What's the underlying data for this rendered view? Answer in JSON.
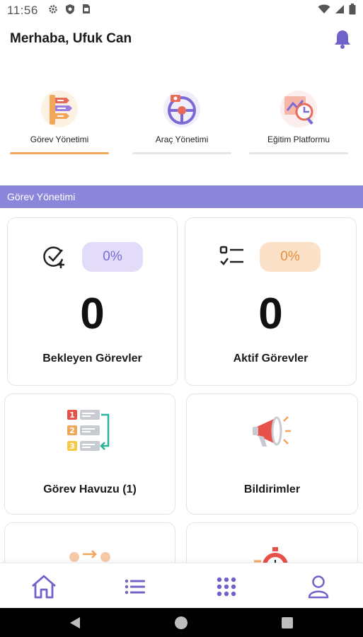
{
  "status_bar": {
    "time": "11:56",
    "icons": [
      "settings-icon",
      "shield-icon",
      "sim-icon",
      "wifi-icon",
      "signal-icon",
      "battery-icon"
    ]
  },
  "header": {
    "greeting": "Merhaba, Ufuk Can",
    "notification_icon": "bell-icon"
  },
  "top_menu": {
    "items": [
      {
        "label": "Görev Yönetimi",
        "icon": "task-list-icon",
        "active": true
      },
      {
        "label": "Araç Yönetimi",
        "icon": "steering-wheel-icon",
        "active": false
      },
      {
        "label": "Eğitim Platformu",
        "icon": "analytics-icon",
        "active": false
      }
    ]
  },
  "section": {
    "title": "Görev Yönetimi"
  },
  "stats": [
    {
      "label": "Bekleyen Görevler",
      "percent": "0%",
      "value": "0",
      "icon": "check-plus-icon",
      "pill_color": "#e3dcf8"
    },
    {
      "label": "Aktif Görevler",
      "percent": "0%",
      "value": "0",
      "icon": "checklist-icon",
      "pill_color": "#fbe1c8"
    }
  ],
  "features": [
    {
      "label": "Görev Havuzu (1)",
      "icon": "numbered-list-icon"
    },
    {
      "label": "Bildirimler",
      "icon": "megaphone-icon"
    },
    {
      "label": "",
      "icon": "people-exchange-icon"
    },
    {
      "label": "",
      "icon": "stopwatch-icon"
    }
  ],
  "bottom_nav": {
    "items": [
      "home-icon",
      "list-icon",
      "grid-icon",
      "profile-icon"
    ]
  },
  "colors": {
    "accent": "#8c86da",
    "active_underline": "#f2a65a",
    "nav_icon": "#6f63c9"
  }
}
